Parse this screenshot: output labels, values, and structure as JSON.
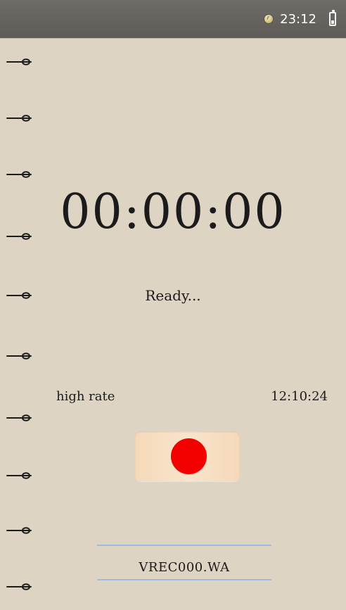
{
  "status_bar": {
    "time": "23:12",
    "icons": {
      "alarm": "alarm-icon",
      "battery": "battery-icon"
    }
  },
  "binder": {
    "ring_count": 10
  },
  "recorder": {
    "timer": "00:00:00",
    "status": "Ready...",
    "rate": "high rate",
    "clock": "12:10:24",
    "record_button_icon": "record-icon",
    "filename": "VREC000.WA"
  },
  "colors": {
    "background": "#ded4c3",
    "status_bar": "#6f6b66",
    "record_dot": "#f30000",
    "file_lines": "#9bbbe2"
  }
}
